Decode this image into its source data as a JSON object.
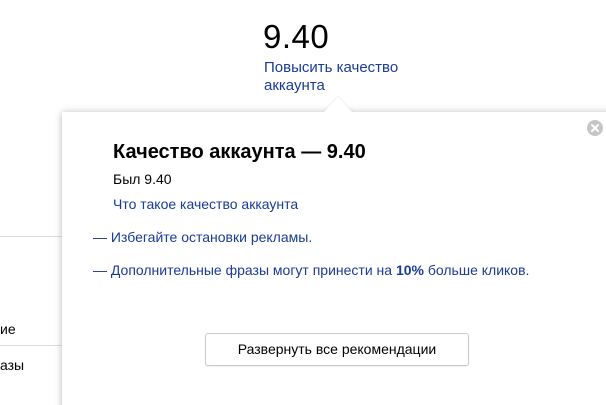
{
  "header": {
    "score_value": "9.40",
    "improve_link": "Повысить качество аккаунта"
  },
  "background": {
    "fragment_1": "ие",
    "fragment_2": "азы"
  },
  "popup": {
    "title": "Качество аккаунта — 9.40",
    "was_label": "Был 9.40",
    "what_link": "Что такое качество аккаунта",
    "recommendations": [
      {
        "dash": "— ",
        "text": "Избегайте остановки рекламы."
      },
      {
        "dash": "— ",
        "text_before": "Дополнительные фразы могут принести на ",
        "highlight": "10%",
        "text_after": " больше кликов."
      }
    ],
    "expand_button": "Развернуть все рекомендации",
    "close_icon": "close-icon"
  },
  "colors": {
    "link": "#1a3b96",
    "text": "#000000",
    "close_bg": "#c6c6c6"
  }
}
